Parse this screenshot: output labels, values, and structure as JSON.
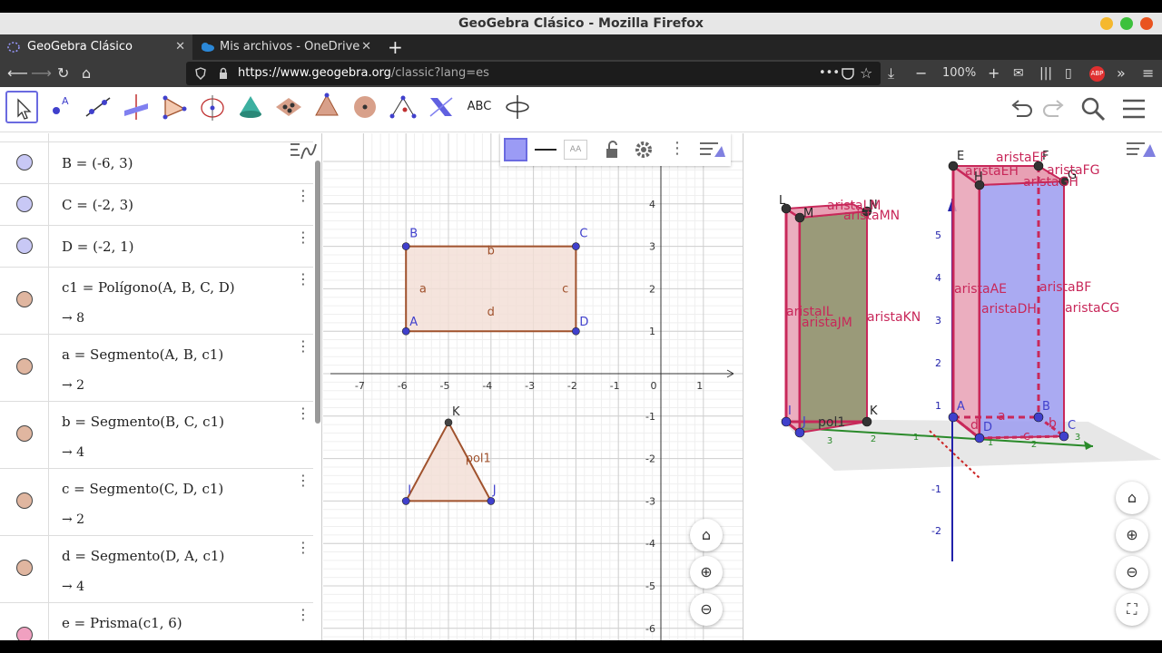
{
  "window": {
    "title": "GeoGebra Clásico - Mozilla Firefox"
  },
  "tabs": [
    {
      "label": "GeoGebra Clásico",
      "active": true
    },
    {
      "label": "Mis archivos - OneDrive",
      "active": false
    }
  ],
  "browser": {
    "url_host": "https://www.geogebra.org",
    "url_path": "/classic?lang=es",
    "zoom": "100%",
    "new_tab": "+",
    "close_glyph": "✕"
  },
  "toolbar": {
    "text_tool_label": "ABC",
    "tools": [
      "move-tool",
      "point-tool",
      "line-tool",
      "perpendicular-line-tool",
      "polygon-tool",
      "circle-tool",
      "cone-tool",
      "intersect-tool",
      "pyramid-tool",
      "sphere-tool",
      "angle-tool",
      "reflect-tool",
      "text-tool",
      "rotate-view-tool"
    ]
  },
  "algebra": {
    "rows": [
      {
        "def": "B = (-6, 3)",
        "color": "#c8c8f5"
      },
      {
        "def": "C = (-2, 3)",
        "color": "#c8c8f5"
      },
      {
        "def": "D = (-2, 1)",
        "color": "#c8c8f5"
      },
      {
        "def": "c1 = Polígono(A, B, C, D)",
        "value": "→  8",
        "color": "#e0b6a0"
      },
      {
        "def": "a = Segmento(A, B, c1)",
        "value": "→  2",
        "color": "#e0b6a0"
      },
      {
        "def": "b = Segmento(B, C, c1)",
        "value": "→  4",
        "color": "#e0b6a0"
      },
      {
        "def": "c = Segmento(C, D, c1)",
        "value": "→  2",
        "color": "#e0b6a0"
      },
      {
        "def": "d = Segmento(D, A, c1)",
        "value": "→  4",
        "color": "#e0b6a0"
      },
      {
        "def": "e = Prisma(c1, 6)",
        "color": "#f0a0c0"
      }
    ]
  },
  "graphics2d": {
    "x_ticks": [
      "-7",
      "-6",
      "-5",
      "-4",
      "-3",
      "-2",
      "-1",
      "0",
      "1"
    ],
    "y_ticks": [
      "4",
      "3",
      "2",
      "1",
      "-1",
      "-2",
      "-3",
      "-4",
      "-5",
      "-6"
    ],
    "points": {
      "A": "A",
      "B": "B",
      "C": "C",
      "D": "D",
      "I": "I",
      "J": "J",
      "K": "K"
    },
    "segments": {
      "a": "a",
      "b": "b",
      "c": "c",
      "d": "d"
    },
    "polygon_label": "pol1",
    "colors": {
      "polygon_fill": "#f3ddd4",
      "polygon_edge": "#a0522d",
      "point": "#4040cc"
    }
  },
  "view3d": {
    "labels": {
      "L": "L",
      "M": "M",
      "N": "N",
      "E": "E",
      "F": "F",
      "H": "H",
      "G": "G",
      "A": "A",
      "B": "B",
      "C": "C",
      "D": "D",
      "I": "I",
      "J": "J",
      "K": "K",
      "aristaEF": "aristaEF",
      "aristaEH": "aristaEH",
      "aristaFG": "aristaFG",
      "aristaGH": "aristaGH",
      "aristaMN": "aristaMN",
      "aristaLM": "aristaLM",
      "aristaIL": "aristaIL",
      "aristaJM": "aristaJM",
      "aristaKN": "aristaKN",
      "aristaAE": "aristaAE",
      "aristaDH": "aristaDH",
      "aristaBF": "aristaBF",
      "aristaCG": "aristaCG",
      "pol1": "pol1",
      "a": "a",
      "b": "b",
      "c": "c",
      "d": "d"
    },
    "z_ticks": [
      "5",
      "4",
      "3",
      "2",
      "1",
      "-1",
      "-2"
    ],
    "y_ticks": [
      "3",
      "2",
      "1",
      "1",
      "2",
      "3"
    ],
    "colors": {
      "prism_blue": "#9b9bf0",
      "prism_edge": "#c8285a",
      "prism_face": "#e8a0b4",
      "olive": "#8f8f6a"
    }
  }
}
